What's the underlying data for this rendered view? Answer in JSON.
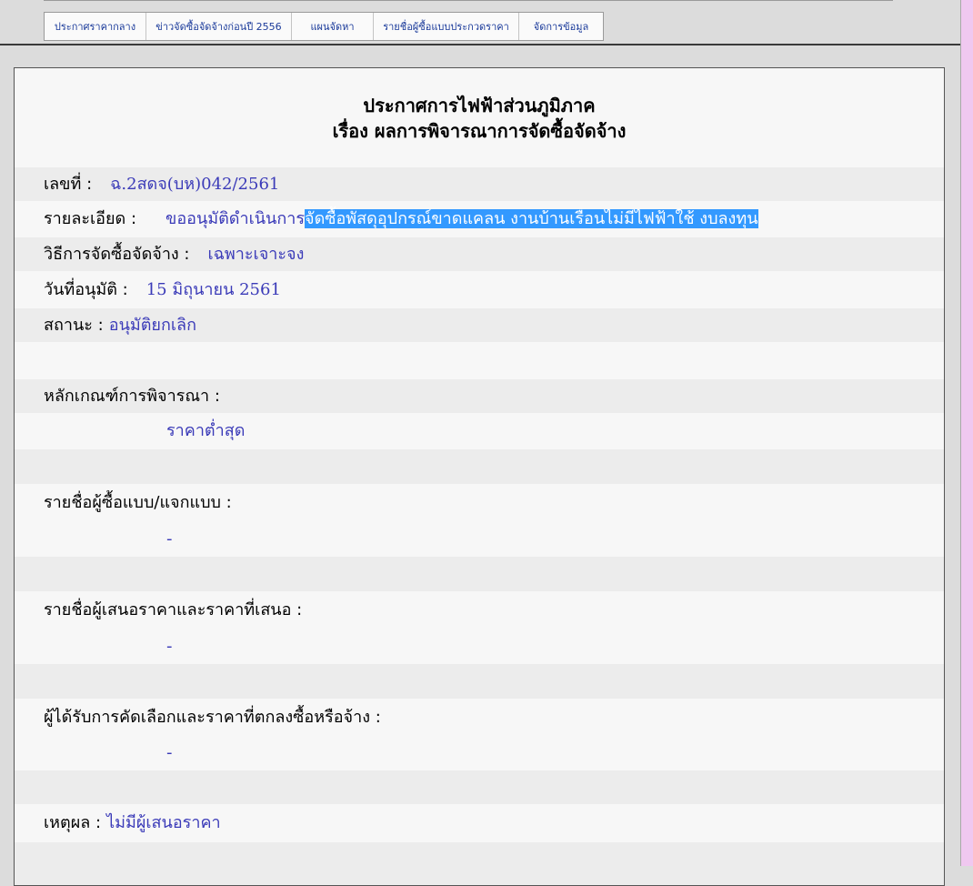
{
  "nav": [
    {
      "label": "ประกาศราคากลาง"
    },
    {
      "label": "ข่าวจัดซื้อจัดจ้างก่อนปี 2556"
    },
    {
      "label": "แผนจัดหา"
    },
    {
      "label": "รายชื่อผู้ซื้อแบบประกวดราคา"
    },
    {
      "label": "จัดการข้อมูล"
    }
  ],
  "title": {
    "line1": "ประกาศการไฟฟ้าส่วนภูมิภาค",
    "line2": "เรื่อง ผลการพิจารณาการจัดซื้อจัดจ้าง"
  },
  "fields": {
    "number_label": "เลขที่ :",
    "number_value": "ฉ.2สดจ(บห)042/2561",
    "detail_label": "รายละเอียด :",
    "detail_value_plain": "ขออนุมัติดำเนินการ",
    "detail_value_selected": "จัดซื้อพัสดุอุปกรณ์ขาดแคลน งานบ้านเรือนไม่มีไฟฟ้าใช้ งบลงทุน",
    "method_label": "วิธีการจัดซื้อจัดจ้าง :",
    "method_value": "เฉพาะเจาะจง",
    "approve_date_label": "วันที่อนุมัติ :",
    "approve_date_value": "15 มิถุนายน 2561",
    "status_label": "สถานะ :",
    "status_value": "อนุมัติยกเลิก",
    "criteria_label": "หลักเกณฑ์การพิจารณา :",
    "criteria_value": "ราคาต่ำสุด",
    "buyers_label": "รายชื่อผู้ซื้อแบบ/แจกแบบ :",
    "buyers_value": "-",
    "bidders_label": "รายชื่อผู้เสนอราคาและราคาที่เสนอ :",
    "bidders_value": "-",
    "winner_label": "ผู้ได้รับการคัดเลือกและราคาที่ตกลงซื้อหรือจ้าง :",
    "winner_value": "-",
    "reason_label": "เหตุผล :",
    "reason_value": "ไม่มีผู้เสนอราคา"
  },
  "colors": {
    "value_text": "#3a3ab8",
    "selection": "#3399ff",
    "right_strip": "#f0c8f0"
  }
}
